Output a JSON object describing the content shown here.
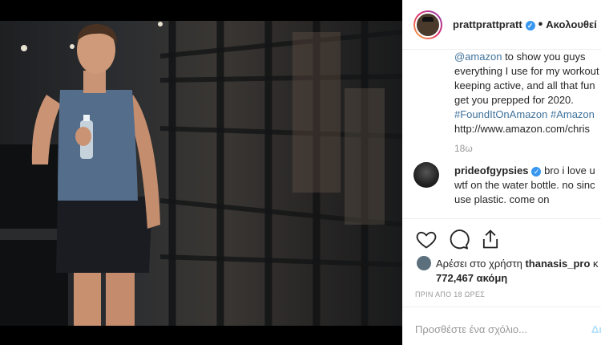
{
  "post": {
    "username": "prattprattpratt",
    "follow_label": "Ακολουθεί",
    "caption_lines": [
      "@amazon to show you guys",
      "everything I use for my workout",
      "keeping active, and all that fun",
      "get you prepped for 2020.",
      "#FoundItOnAmazon #Amazon",
      "http://www.amazon.com/chris"
    ],
    "caption_time": "18ω"
  },
  "comment": {
    "username": "prideofgypsies",
    "text_first": "bro i love u",
    "lines": [
      "wtf on the water bottle. no sinc",
      "use plastic. come on"
    ]
  },
  "likes": {
    "prefix": "Αρέσει στο χρήστη",
    "liker": "thanasis_pro",
    "suffix": "κ",
    "count_line": "772,467 ακόμη"
  },
  "posted": "ΠΡΙΝ ΑΠΟ 18 ΩΡΕΣ",
  "add_comment": {
    "placeholder": "Προσθέστε ένα σχόλιο...",
    "post_label": "Δη"
  },
  "icons": {
    "verified": "✓"
  }
}
